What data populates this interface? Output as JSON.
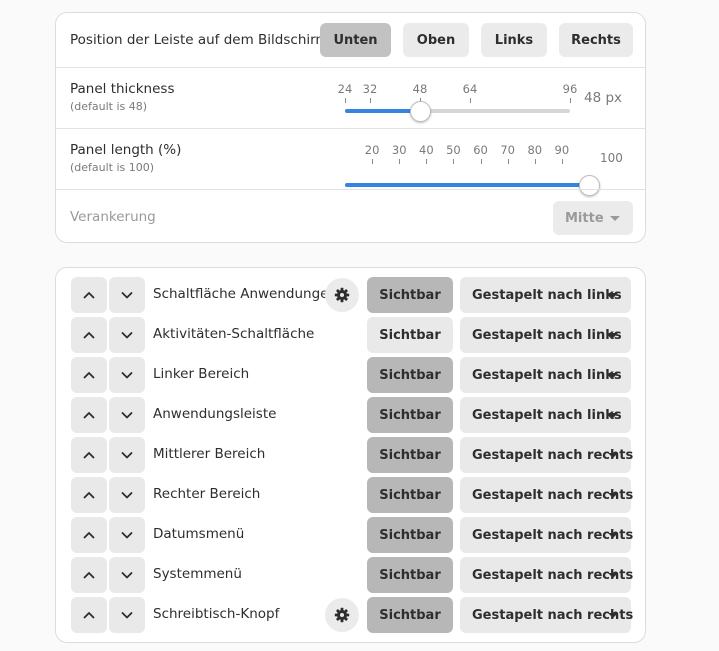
{
  "position": {
    "label": "Position der Leiste auf dem Bildschirm",
    "options": [
      "Unten",
      "Oben",
      "Links",
      "Rechts"
    ],
    "selected": "Unten"
  },
  "thickness": {
    "label": "Panel thickness",
    "sublabel": "(default is 48)",
    "ticks": [
      "24",
      "32",
      "48",
      "64",
      "96"
    ],
    "value": 48,
    "min": 24,
    "max": 96,
    "value_text": "48 px"
  },
  "length": {
    "label": "Panel length (%)",
    "sublabel": "(default is 100)",
    "ticks": [
      "20",
      "30",
      "40",
      "50",
      "60",
      "70",
      "80",
      "90"
    ],
    "value": 100,
    "min": 10,
    "max": 100,
    "value_text": "100"
  },
  "anchor": {
    "label": "Verankerung",
    "value": "Mitte"
  },
  "items": [
    {
      "name": "Schaltfläche Anwendungen",
      "has_gear": true,
      "visibility": "Sichtbar",
      "visible": true,
      "position": "Gestapelt nach links"
    },
    {
      "name": "Aktivitäten-Schaltfläche",
      "has_gear": false,
      "visibility": "Sichtbar",
      "visible": false,
      "position": "Gestapelt nach links"
    },
    {
      "name": "Linker Bereich",
      "has_gear": false,
      "visibility": "Sichtbar",
      "visible": true,
      "position": "Gestapelt nach links"
    },
    {
      "name": "Anwendungsleiste",
      "has_gear": false,
      "visibility": "Sichtbar",
      "visible": true,
      "position": "Gestapelt nach links"
    },
    {
      "name": "Mittlerer Bereich",
      "has_gear": false,
      "visibility": "Sichtbar",
      "visible": true,
      "position": "Gestapelt nach rechts"
    },
    {
      "name": "Rechter Bereich",
      "has_gear": false,
      "visibility": "Sichtbar",
      "visible": true,
      "position": "Gestapelt nach rechts"
    },
    {
      "name": "Datumsmenü",
      "has_gear": false,
      "visibility": "Sichtbar",
      "visible": true,
      "position": "Gestapelt nach rechts"
    },
    {
      "name": "Systemmenü",
      "has_gear": false,
      "visibility": "Sichtbar",
      "visible": true,
      "position": "Gestapelt nach rechts"
    },
    {
      "name": "Schreibtisch-Knopf",
      "has_gear": true,
      "visibility": "Sichtbar",
      "visible": true,
      "position": "Gestapelt nach rechts"
    }
  ],
  "icons": {
    "up": "chevron-up-icon",
    "down": "chevron-down-icon",
    "gear": "gear-icon",
    "dropdown": "pan-down-icon"
  },
  "colors": {
    "accent": "#3584e4",
    "active_button": "#c2c2c2",
    "visible_button": "#b7b7b7"
  }
}
